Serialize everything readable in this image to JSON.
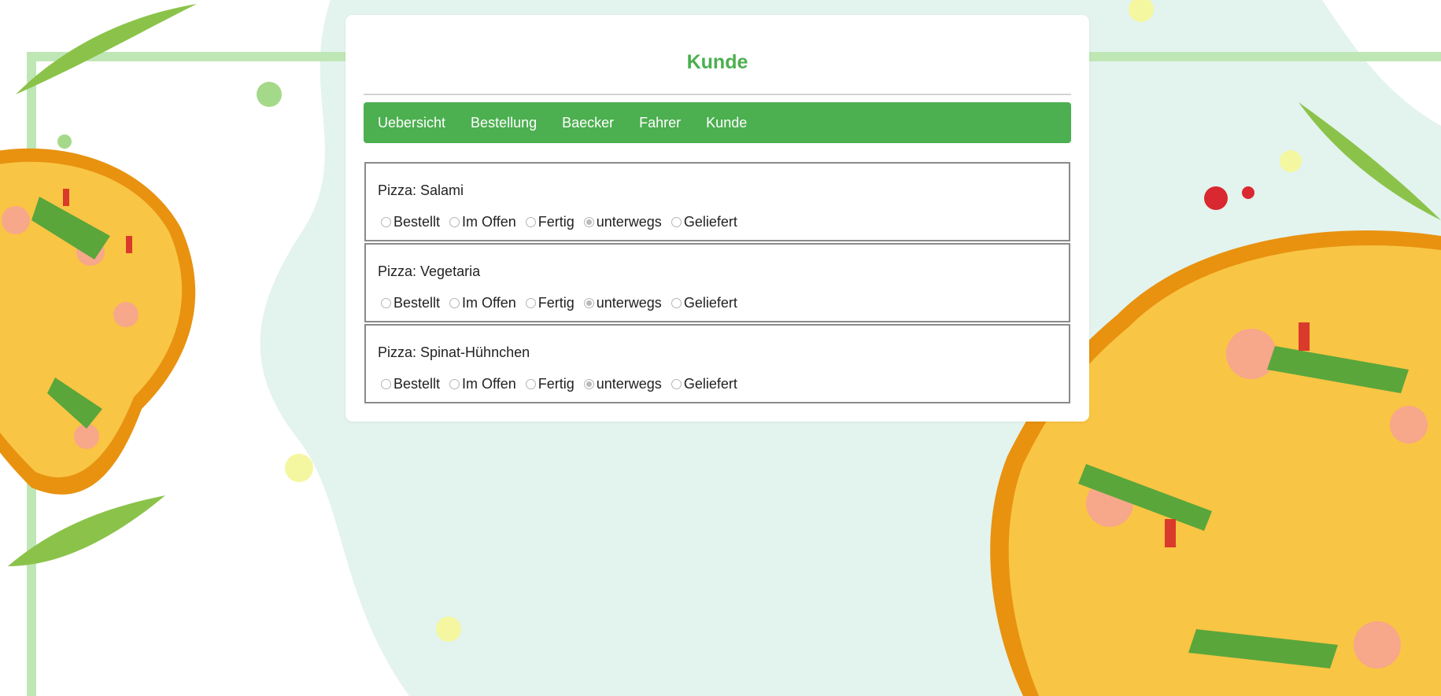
{
  "page": {
    "title": "Kunde"
  },
  "nav": {
    "items": [
      "Uebersicht",
      "Bestellung",
      "Baecker",
      "Fahrer",
      "Kunde"
    ]
  },
  "status_options": [
    "Bestellt",
    "Im Offen",
    "Fertig",
    "unterwegs",
    "Geliefert"
  ],
  "orders": [
    {
      "label": "Pizza: Salami",
      "selected_status": "unterwegs"
    },
    {
      "label": "Pizza: Vegetaria",
      "selected_status": "unterwegs"
    },
    {
      "label": "Pizza: Spinat-Hühnchen",
      "selected_status": "unterwegs"
    }
  ],
  "colors": {
    "accent": "#4caf50",
    "background": "#e3f3ee"
  }
}
